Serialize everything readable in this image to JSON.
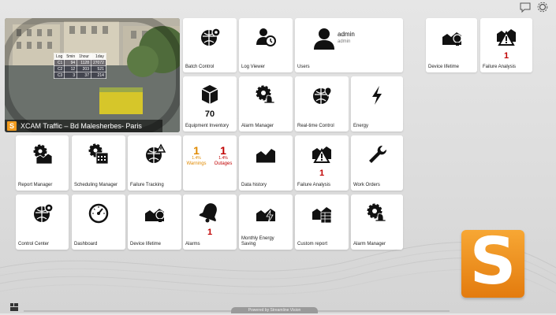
{
  "camera": {
    "caption": "XCAM Traffic – Bd Malesherbes- Paris",
    "logo_letter": "S",
    "stats_headers": [
      "Log",
      "5min",
      "1hour",
      "1day"
    ],
    "stats_rows": [
      [
        "C1",
        "94",
        "1128",
        "27072"
      ],
      [
        "C2",
        "12",
        "203",
        "521"
      ],
      [
        "C3",
        "3",
        "37",
        "214"
      ]
    ]
  },
  "tiles": {
    "batch_control": "Batch Control",
    "log_viewer": "Log Viewer",
    "users": "Users",
    "user_name": "admin",
    "user_role": "admin",
    "device_lifetime_top": "Device lifetime",
    "failure_analysis_top": "Failure Analysis",
    "failure_analysis_top_count": "1",
    "equipment_inventory": "Equipment Inventory",
    "equipment_inventory_count": "70",
    "alarm_manager_top": "Alarm Manager",
    "realtime_control": "Real-time Control",
    "energy": "Energy",
    "report_manager": "Report Manager",
    "scheduling_manager": "Scheduling Manager",
    "failure_tracking": "Failure Tracking",
    "warnings_count": "1",
    "warnings_pct": "1.4%",
    "warnings_label": "Warnings",
    "outages_count": "1",
    "outages_pct": "1.4%",
    "outages_label": "Outages",
    "data_history": "Data history",
    "failure_analysis_mid": "Failure Analysis",
    "failure_analysis_mid_count": "1",
    "work_orders": "Work Orders",
    "control_center": "Control Center",
    "dashboard": "Dashboard",
    "device_lifetime_bottom": "Device lifetime",
    "alarms": "Alarms",
    "alarms_count": "1",
    "monthly_energy_line1": "Monthly Energy",
    "monthly_energy_line2": "Saving",
    "custom_report": "Custom report",
    "alarm_manager_bottom": "Alarm Manager"
  },
  "brand": {
    "logo_letter": "S",
    "accent": "#f29b1d"
  },
  "footer": {
    "powered": "Powered by Streamline Vision"
  }
}
